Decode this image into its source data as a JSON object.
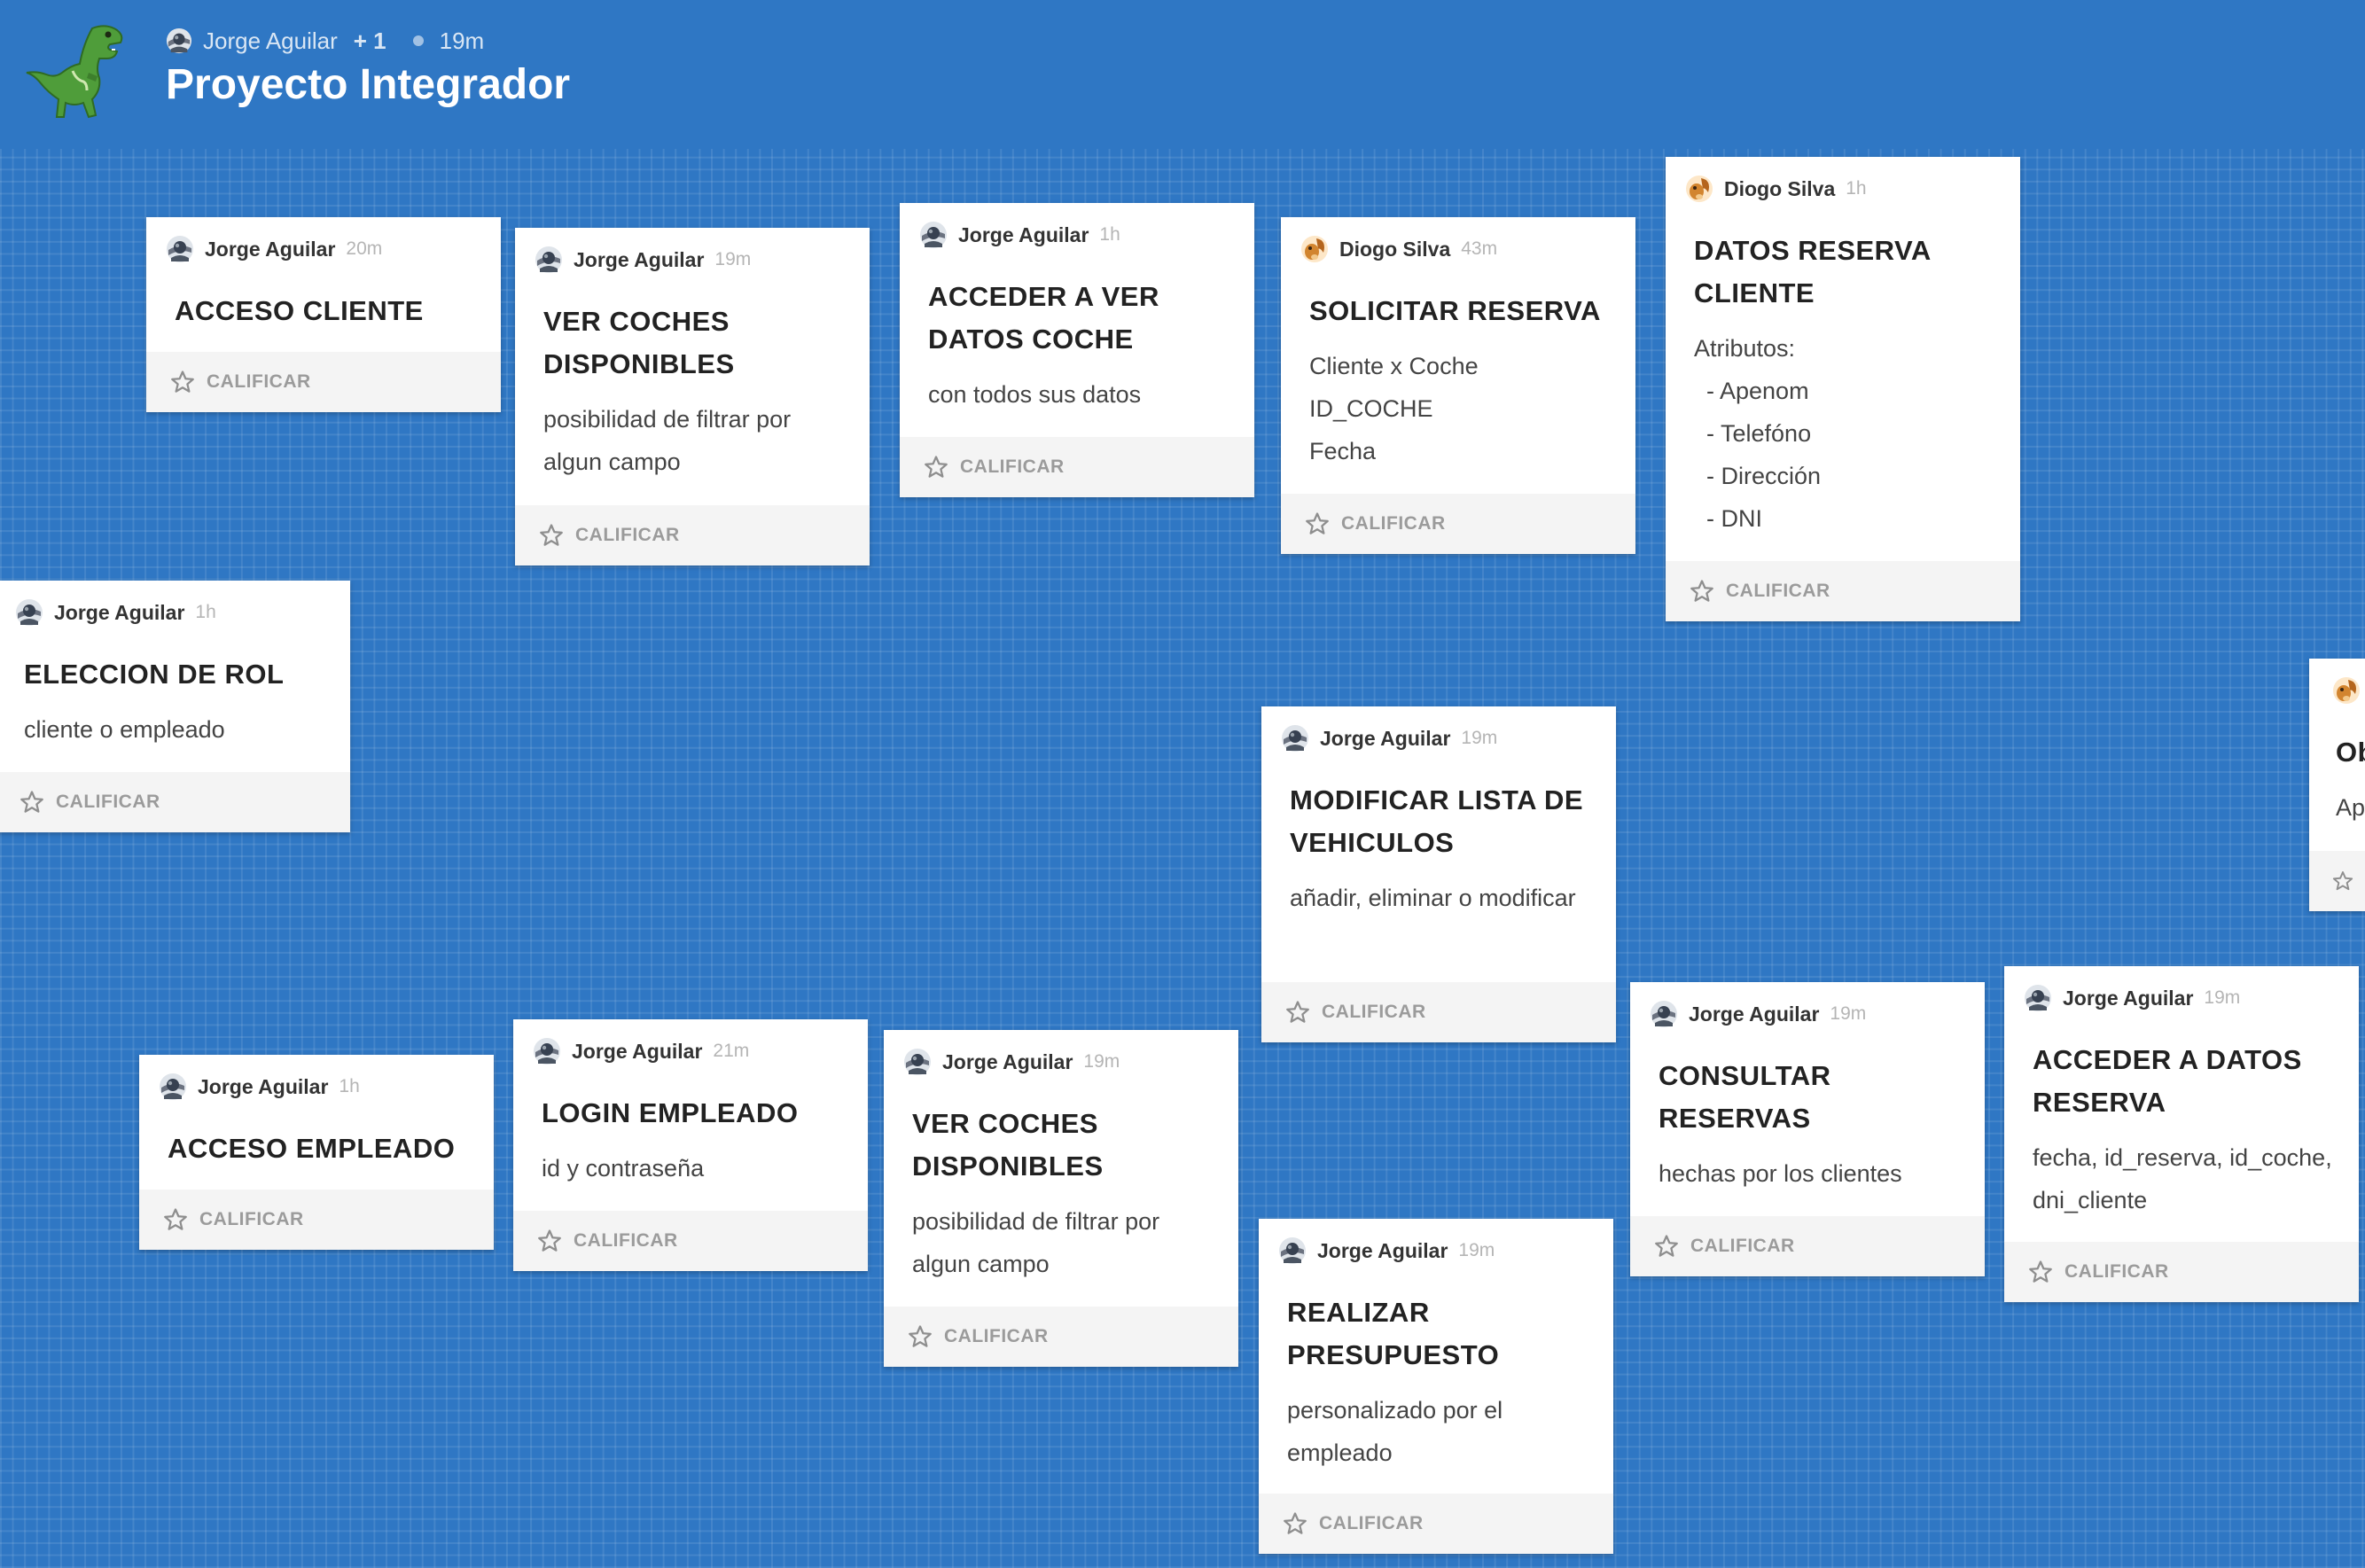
{
  "board": {
    "author": "Jorge Aguilar",
    "collaborators": "+ 1",
    "time": "19m",
    "title": "Proyecto Integrador"
  },
  "colors": {
    "background": "#2f77c4",
    "card": "#ffffff",
    "card_footer": "#f4f4f4",
    "time_text": "#b5b5b5"
  },
  "icons": {
    "logo": "t-rex-dinosaur-icon",
    "avatar_jorge": "planet-avatar-icon",
    "avatar_diogo": "squirrel-avatar-icon",
    "rate": "star-icon"
  },
  "rate_label": "CALIFICAR",
  "cards": [
    {
      "author": "Jorge Aguilar",
      "time": "20m",
      "title": "ACCESO CLIENTE"
    },
    {
      "author": "Jorge Aguilar",
      "time": "19m",
      "title": "VER COCHES DISPONIBLES",
      "body": "posibilidad de filtrar por algun campo"
    },
    {
      "author": "Jorge Aguilar",
      "time": "1h",
      "title": "ACCEDER A VER DATOS COCHE",
      "body": "con todos sus datos"
    },
    {
      "author": "Diogo Silva",
      "time": "43m",
      "title": "SOLICITAR RESERVA",
      "lines": [
        "Cliente x Coche",
        "ID_COCHE",
        "Fecha"
      ]
    },
    {
      "author": "Diogo Silva",
      "time": "1h",
      "title": "DATOS RESERVA CLIENTE",
      "lines": [
        "Atributos:",
        "- Apenom",
        "- Telefóno",
        "- Dirección",
        "- DNI"
      ]
    },
    {
      "author": "Jorge Aguilar",
      "time": "1h",
      "title": "ELECCION DE ROL",
      "body": "cliente o empleado"
    },
    {
      "author": "Jorge Aguilar",
      "time": "19m",
      "title": "MODIFICAR LISTA DE VEHICULOS",
      "body": "añadir, eliminar o modificar"
    },
    {
      "author": "Jorge Aguilar",
      "time": "1h",
      "title": "ACCESO EMPLEADO"
    },
    {
      "author": "Jorge Aguilar",
      "time": "21m",
      "title": "LOGIN EMPLEADO",
      "body": "id y contraseña"
    },
    {
      "author": "Jorge Aguilar",
      "time": "19m",
      "title": "VER COCHES DISPONIBLES",
      "body": "posibilidad de filtrar por algun campo"
    },
    {
      "author": "Jorge Aguilar",
      "time": "19m",
      "title": "REALIZAR PRESUPUESTO",
      "body": "personalizado por el empleado"
    },
    {
      "author": "Jorge Aguilar",
      "time": "19m",
      "title": "CONSULTAR RESERVAS",
      "body": "hechas por los clientes"
    },
    {
      "author": "Jorge Aguilar",
      "time": "19m",
      "title": "ACCEDER A DATOS RESERVA",
      "body": "fecha, id_reserva, id_coche, dni_cliente"
    },
    {
      "title": "Ob",
      "body": "Ap"
    }
  ]
}
